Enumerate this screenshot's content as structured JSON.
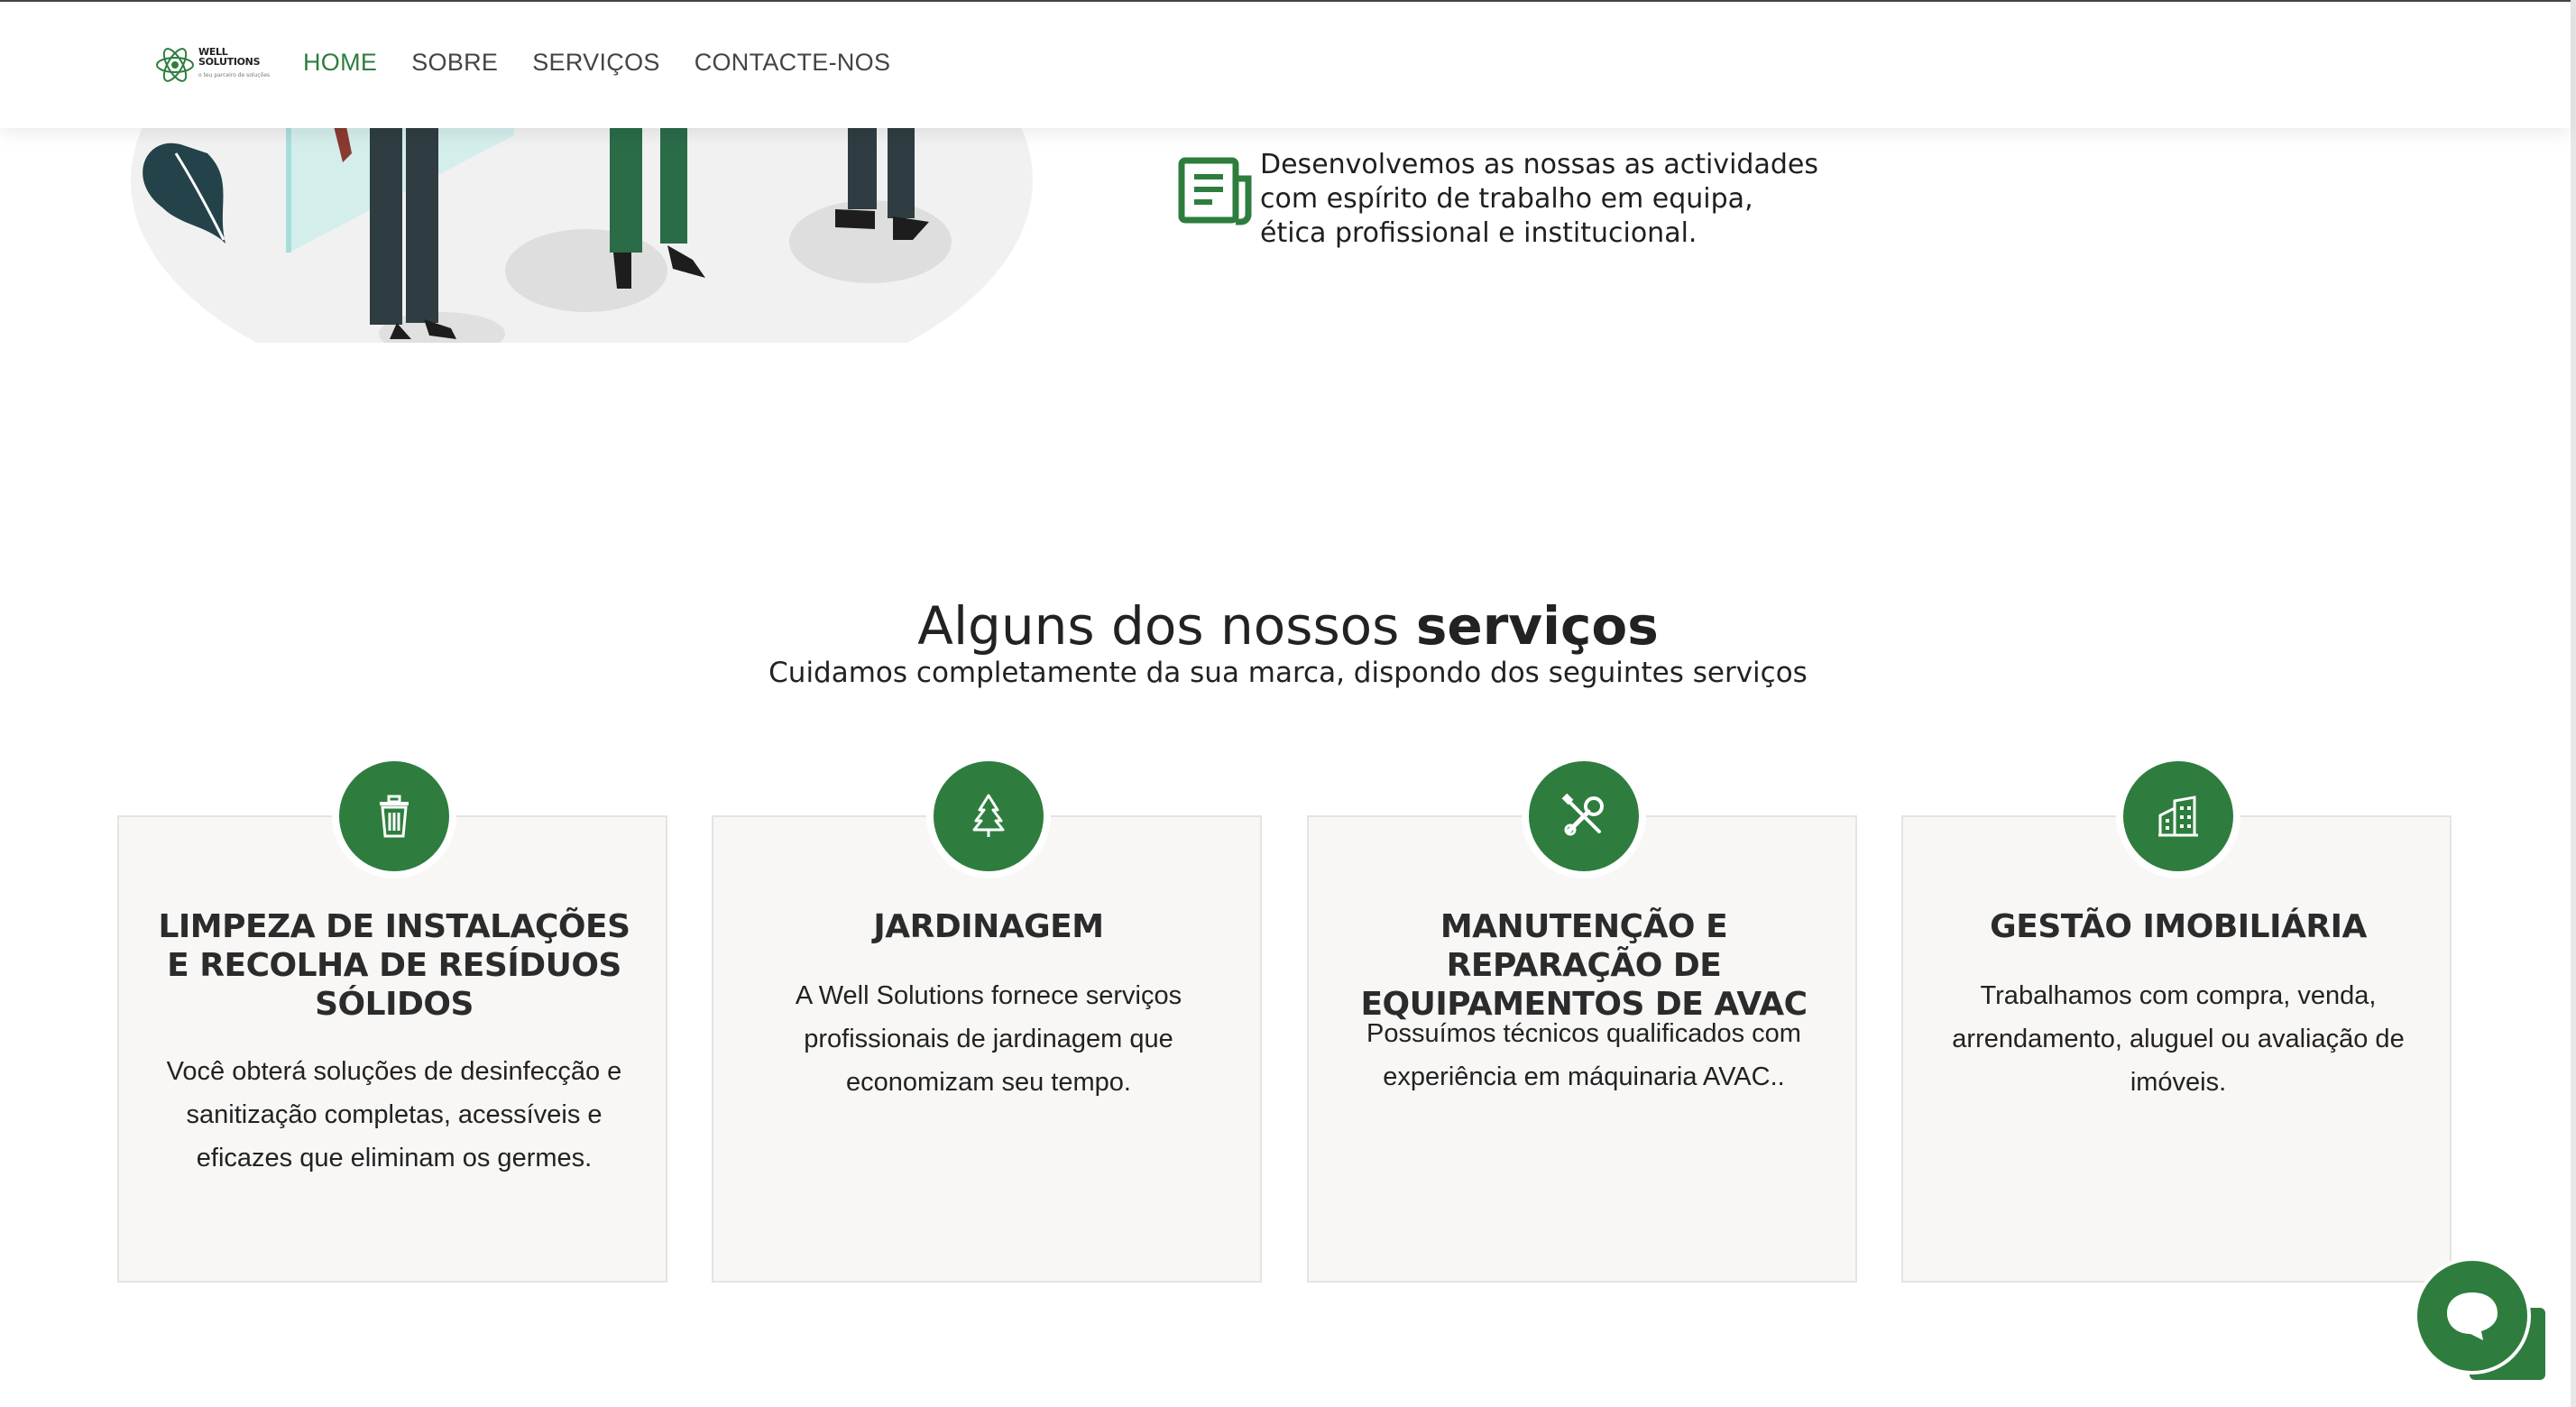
{
  "header": {
    "logo": {
      "line1": "WELL",
      "line2": "SOLUTIONS",
      "tagline": "o teu parceiro de soluções"
    },
    "nav": [
      {
        "label": "HOME",
        "active": true
      },
      {
        "label": "SOBRE",
        "active": false
      },
      {
        "label": "SERVIÇOS",
        "active": false
      },
      {
        "label": "CONTACTE-NOS",
        "active": false
      }
    ]
  },
  "values": {
    "team_text": "Desenvolvemos as nossas as actividades com espírito de trabalho em equipa, ética profissional e institucional.",
    "icon": "newspaper-icon"
  },
  "services": {
    "title_prefix": "Alguns dos nossos ",
    "title_bold": "serviços",
    "subtitle": "Cuidamos completamente da sua marca, dispondo dos seguintes serviços",
    "cards": [
      {
        "icon": "trash-icon",
        "title": "LIMPEZA DE INSTALAÇÕES E RECOLHA DE RESÍDUOS SÓLIDOS",
        "text": "Você obterá soluções de desinfecção e sanitização completas, acessíveis e eficazes que eliminam os germes."
      },
      {
        "icon": "tree-icon",
        "title": "JARDINAGEM",
        "text": "A Well Solutions fornece serviços profissionais de jardinagem que economizam seu tempo."
      },
      {
        "icon": "tools-icon",
        "title": "MANUTENÇÃO E REPARAÇÃO DE EQUIPAMENTOS DE AVAC",
        "text": "Possuímos técnicos qualificados com experiência em máquinaria AVAC.."
      },
      {
        "icon": "building-icon",
        "title": "GESTÃO IMOBILIÁRIA",
        "text": "Trabalhamos com compra, venda, arrendamento, aluguel ou avaliação de imóveis."
      }
    ]
  },
  "colors": {
    "brand_green": "#2e7d3e",
    "card_bg": "#f8f7f5",
    "text": "#222222"
  }
}
